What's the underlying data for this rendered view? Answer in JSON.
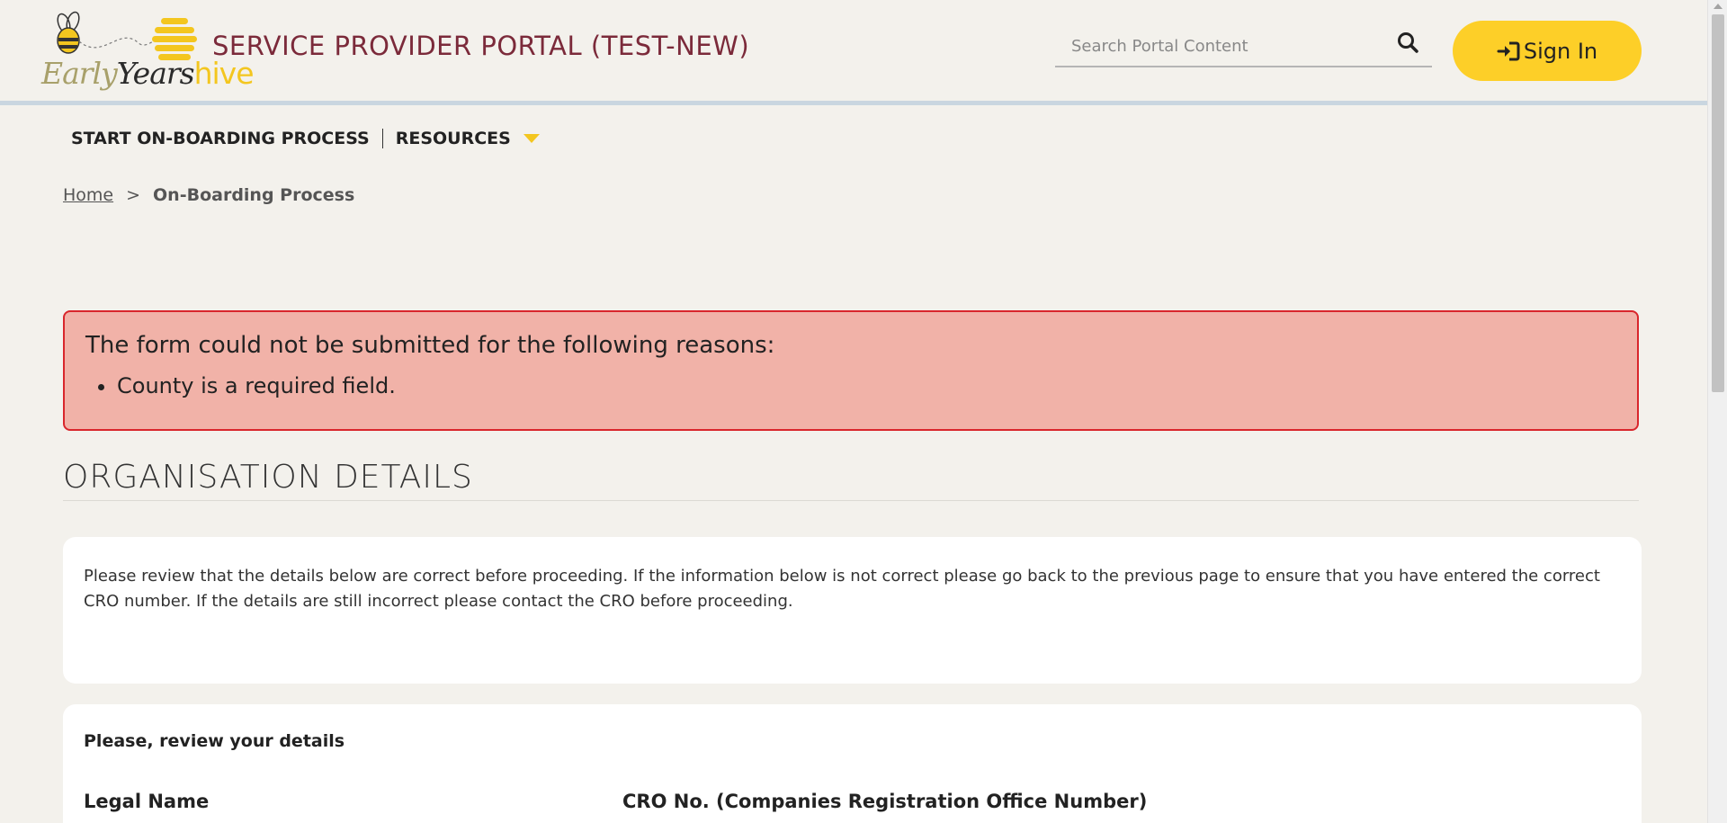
{
  "header": {
    "logo": {
      "early": "Early",
      "years": "Years",
      "hive": "hive"
    },
    "site_title": "SERVICE PROVIDER PORTAL (TEST-NEW)",
    "search_placeholder": "Search Portal Content",
    "search_icon": "search-icon",
    "signin_icon": "sign-in-icon",
    "signin_label": "Sign In"
  },
  "nav": {
    "items": [
      {
        "label": "START ON-BOARDING PROCESS"
      },
      {
        "label": "RESOURCES"
      }
    ],
    "dropdown_icon": "caret-down-icon"
  },
  "breadcrumb": {
    "home": "Home",
    "separator": ">",
    "current": "On-Boarding Process"
  },
  "alert": {
    "title": "The form could not be submitted for the following reasons:",
    "errors": [
      "County is a required field."
    ]
  },
  "section": {
    "title": "ORGANISATION DETAILS"
  },
  "info_card": {
    "text": "Please review that the details below are correct before proceeding. If the information below is not correct please go back to the previous page to ensure that you have entered the correct CRO number. If the details are still incorrect please contact the CRO before proceeding."
  },
  "review_card": {
    "heading": "Please, review your details",
    "labels": [
      "Legal Name",
      "CRO No. (Companies Registration Office Number)"
    ]
  },
  "colors": {
    "background": "#f3f1ec",
    "brand_title": "#7b2a3a",
    "accent_yellow": "#fdcf28",
    "alert_bg": "#f1b2a8",
    "alert_border": "#d9262c"
  }
}
